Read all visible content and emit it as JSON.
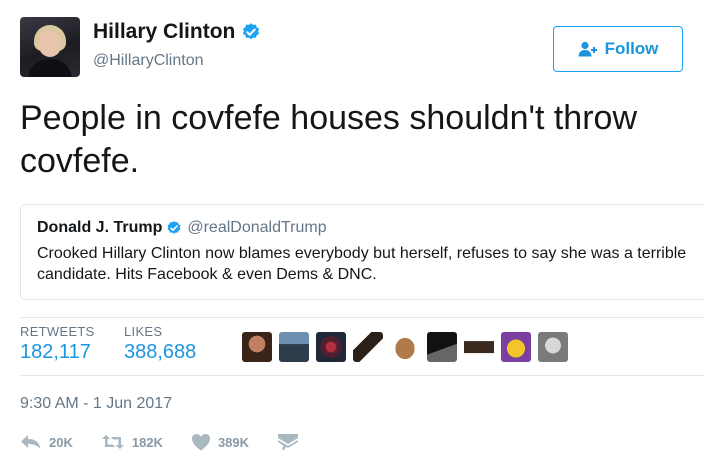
{
  "author": {
    "name": "Hillary Clinton",
    "handle": "@HillaryClinton",
    "verified": true
  },
  "follow_button": {
    "label": "Follow",
    "icon": "add-user-icon"
  },
  "tweet": {
    "text": "People in covfefe houses shouldn't throw covfefe."
  },
  "quoted_tweet": {
    "name": "Donald J. Trump",
    "handle": "@realDonaldTrump",
    "verified": true,
    "text": "Crooked Hillary Clinton now blames everybody but herself, refuses to say she was a terrible candidate. Hits Facebook & even Dems & DNC."
  },
  "stats": {
    "retweets_label": "RETWEETS",
    "retweets_value": "182,117",
    "likes_label": "LIKES",
    "likes_value": "388,688"
  },
  "timestamp": "9:30 AM - 1 Jun 2017",
  "actions": {
    "reply_count": "20K",
    "retweet_count": "182K",
    "like_count": "389K"
  },
  "colors": {
    "accent": "#1da1f2",
    "link": "#1b95e0",
    "muted": "#657786",
    "icon": "#8899a6"
  }
}
